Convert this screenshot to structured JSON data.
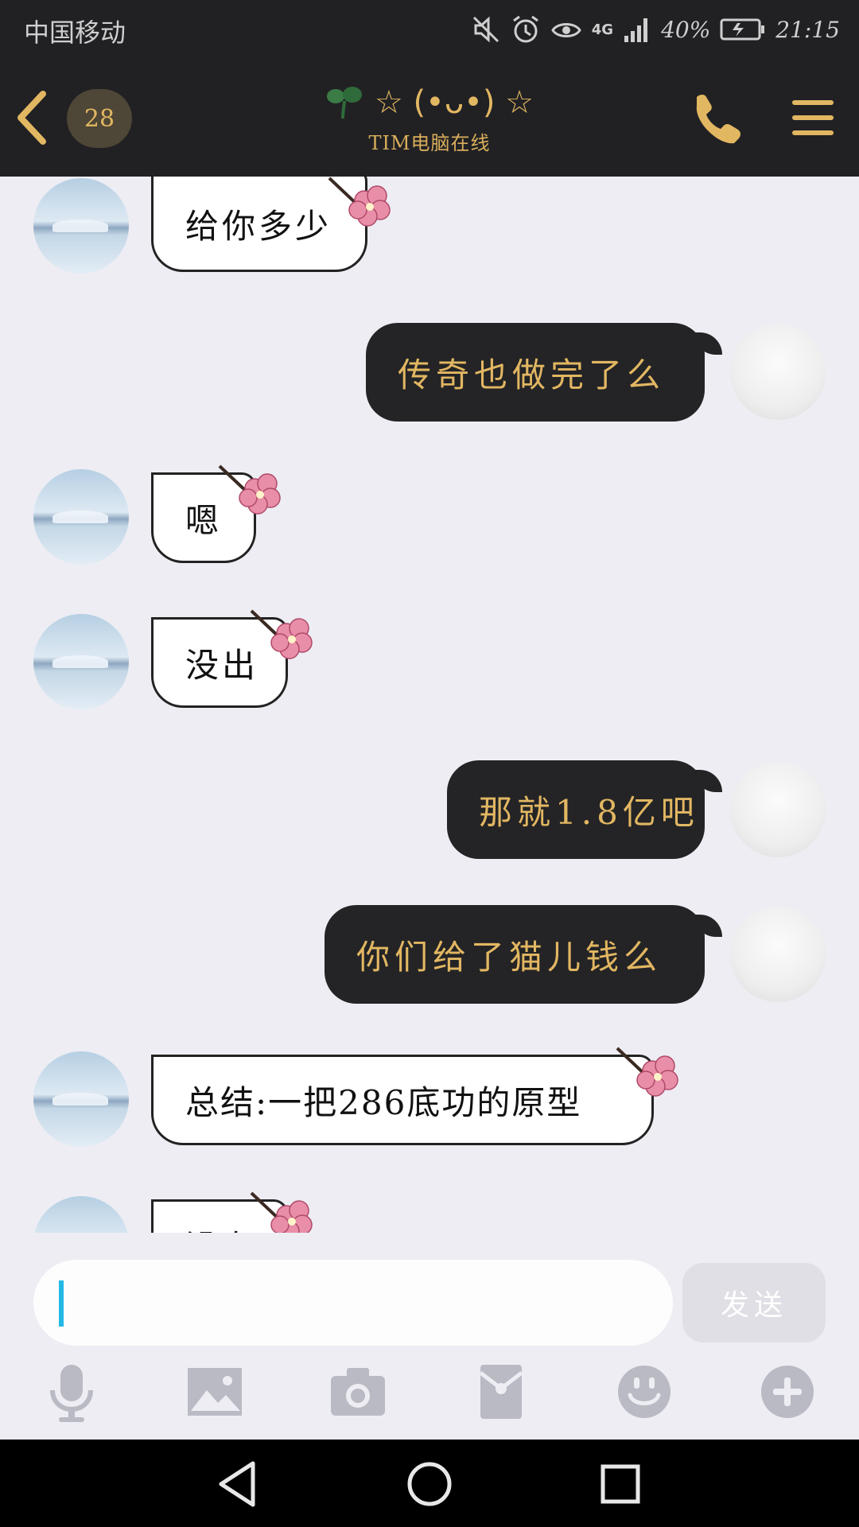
{
  "status_bar": {
    "carrier": "中国移动",
    "network": "4G",
    "battery": "40%",
    "time": "21:15"
  },
  "header": {
    "unread_count": "28",
    "title": "☆ (•ᴗ•) ☆",
    "subtitle": "TIM电脑在线"
  },
  "messages": [
    {
      "side": "left",
      "text": "给你多少"
    },
    {
      "side": "right",
      "text": "传奇也做完了么"
    },
    {
      "side": "left",
      "text": "嗯"
    },
    {
      "side": "left",
      "text": "没出"
    },
    {
      "side": "right",
      "text": "那就1.8亿吧"
    },
    {
      "side": "right",
      "text": "你们给了猫儿钱么"
    },
    {
      "side": "left",
      "text": "总结:一把286底功的原型"
    },
    {
      "side": "left",
      "text": "没有"
    }
  ],
  "composer": {
    "placeholder": "",
    "send_label": "发送"
  },
  "toolbar_icons": [
    "microphone-icon",
    "image-icon",
    "camera-icon",
    "red-packet-icon",
    "emoji-icon",
    "plus-icon"
  ],
  "colors": {
    "bar_bg": "#212124",
    "accent_gold": "#e2b762",
    "chat_bg": "#ededf3",
    "cursor": "#22b8e6"
  }
}
